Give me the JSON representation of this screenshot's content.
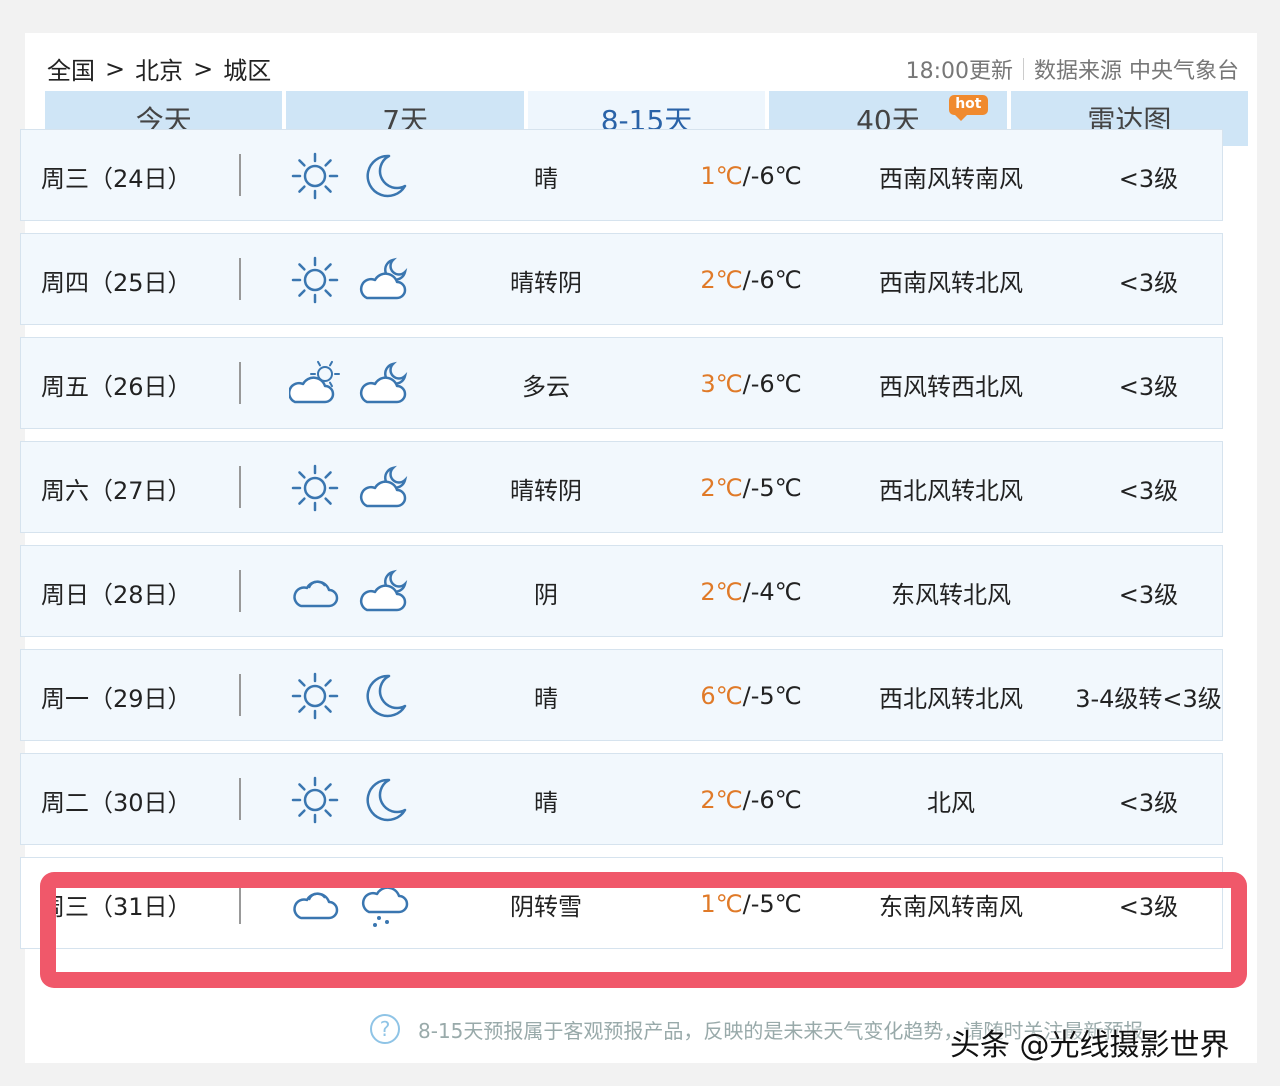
{
  "breadcrumb": [
    "全国",
    "北京",
    "城区"
  ],
  "breadcrumb_sep": ">",
  "update_time": "18:00更新",
  "data_source": "数据来源 中央气象台",
  "tabs": [
    {
      "label": "今天"
    },
    {
      "label": "7天"
    },
    {
      "label": "8-15天",
      "active": true
    },
    {
      "label": "40天",
      "badge": "hot"
    },
    {
      "label": "雷达图"
    }
  ],
  "days": [
    {
      "date": "周三（24日）",
      "icons": [
        "sun-icon",
        "moon-icon"
      ],
      "condition": "晴",
      "high": "1℃",
      "low": "/-6℃",
      "wind": "西南风转南风",
      "level": "<3级"
    },
    {
      "date": "周四（25日）",
      "icons": [
        "sun-icon",
        "moon-cloud-icon"
      ],
      "condition": "晴转阴",
      "high": "2℃",
      "low": "/-6℃",
      "wind": "西南风转北风",
      "level": "<3级"
    },
    {
      "date": "周五（26日）",
      "icons": [
        "sun-cloud-icon",
        "moon-cloud-icon"
      ],
      "condition": "多云",
      "high": "3℃",
      "low": "/-6℃",
      "wind": "西风转西北风",
      "level": "<3级"
    },
    {
      "date": "周六（27日）",
      "icons": [
        "sun-icon",
        "moon-cloud-icon"
      ],
      "condition": "晴转阴",
      "high": "2℃",
      "low": "/-5℃",
      "wind": "西北风转北风",
      "level": "<3级"
    },
    {
      "date": "周日（28日）",
      "icons": [
        "cloud-icon",
        "moon-cloud-icon"
      ],
      "condition": "阴",
      "high": "2℃",
      "low": "/-4℃",
      "wind": "东风转北风",
      "level": "<3级"
    },
    {
      "date": "周一（29日）",
      "icons": [
        "sun-icon",
        "moon-icon"
      ],
      "condition": "晴",
      "high": "6℃",
      "low": "/-5℃",
      "wind": "西北风转北风",
      "level": "3-4级转<3级"
    },
    {
      "date": "周二（30日）",
      "icons": [
        "sun-icon",
        "moon-icon"
      ],
      "condition": "晴",
      "high": "2℃",
      "low": "/-6℃",
      "wind": "北风",
      "level": "<3级"
    },
    {
      "date": "周三（31日）",
      "icons": [
        "cloud-icon",
        "snow-cloud-icon"
      ],
      "condition": "阴转雪",
      "high": "1℃",
      "low": "/-5℃",
      "wind": "东南风转南风",
      "level": "<3级"
    }
  ],
  "footer_note": "8-15天预报属于客观预报产品，反映的是未来天气变化趋势，请随时关注最新预报。",
  "watermark": "头条 @光线摄影世界",
  "colors": {
    "tab_bg": "#cfe5f6",
    "active_tab_text": "#2a63a8",
    "high_temp": "#e07a28",
    "highlight_border": "#f0586a",
    "icon_stroke": "#3a76b0"
  }
}
